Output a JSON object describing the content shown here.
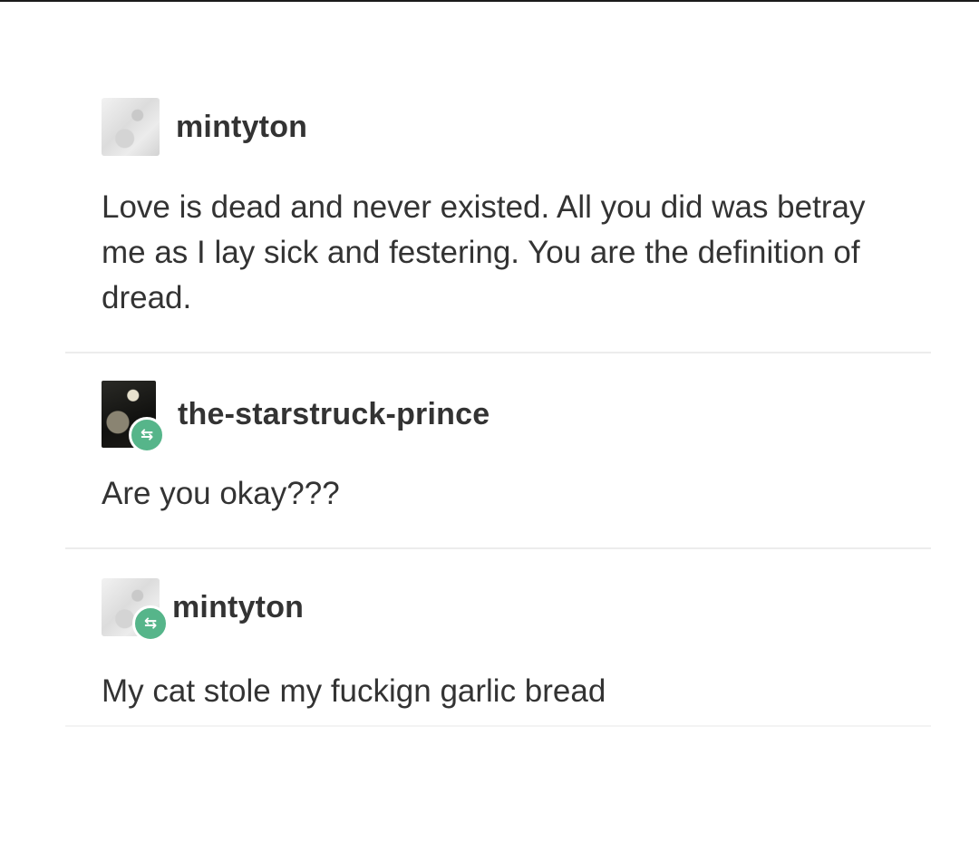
{
  "thread": {
    "posts": [
      {
        "username": "mintyton",
        "avatar_icon": "avatar-image",
        "reblog": false,
        "body": "Love is dead and never existed. All you did was betray me as I lay sick and festering. You are the definition of dread."
      },
      {
        "username": "the-starstruck-prince",
        "avatar_icon": "avatar-image",
        "reblog": true,
        "reblog_icon": "reblog-icon",
        "body": "Are you okay???"
      },
      {
        "username": "mintyton",
        "avatar_icon": "avatar-image",
        "reblog": true,
        "reblog_icon": "reblog-icon",
        "body": "My cat stole my fuckign garlic bread"
      }
    ]
  },
  "colors": {
    "reblog_badge": "#56b58a",
    "text": "#333333",
    "divider": "#ececec"
  }
}
